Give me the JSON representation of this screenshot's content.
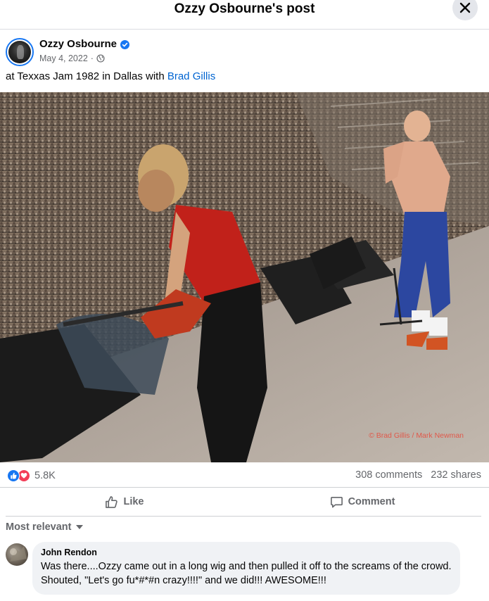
{
  "header": {
    "title": "Ozzy Osbourne's post",
    "close_icon": "close-icon"
  },
  "post": {
    "author": "Ozzy Osbourne",
    "verified_icon": "verified-badge-icon",
    "date": "May 4, 2022",
    "separator": "·",
    "audience_icon": "globe-icon",
    "caption_prefix": "at Texxas Jam 1982 in Dallas with ",
    "caption_tag": "Brad Gillis",
    "photo_credit": "© Brad Gillis / Mark Newman"
  },
  "stats": {
    "reaction_count": "5.8K",
    "comments": "308 comments",
    "shares": "232 shares"
  },
  "actions": {
    "like_label": "Like",
    "comment_label": "Comment"
  },
  "comments_section": {
    "sort_label": "Most relevant"
  },
  "comment": {
    "author": "John Rendon",
    "text": "Was there....Ozzy came out in a long wig and then pulled it off to the screams of the crowd. Shouted, \"Let's go fu*#*#n crazy!!!!\" and we did!!! AWESOME!!!"
  },
  "colors": {
    "link": "#0064d1",
    "accent": "#1877f2",
    "love": "#f33e58",
    "muted": "#65676b"
  }
}
